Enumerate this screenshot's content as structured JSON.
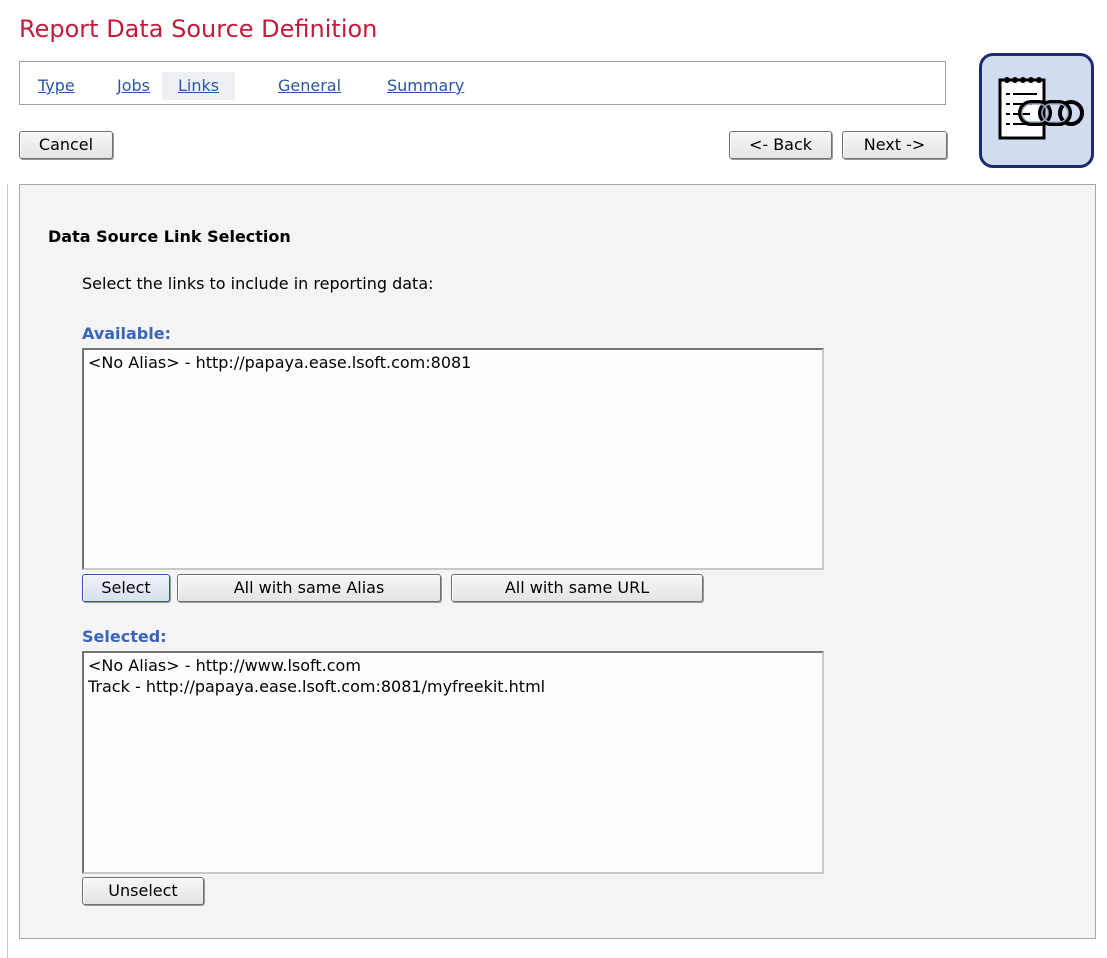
{
  "page": {
    "title": "Report Data Source Definition"
  },
  "tabs": [
    {
      "label": "Type"
    },
    {
      "label": "Jobs"
    },
    {
      "label": "Links"
    },
    {
      "label": "General"
    },
    {
      "label": "Summary"
    }
  ],
  "nav": {
    "cancel": "Cancel",
    "back": "<- Back",
    "next": "Next ->"
  },
  "logo": {
    "icon": "report-link-chain-icon"
  },
  "section": {
    "title": "Data Source Link Selection",
    "instructions": "Select the links to include in reporting data:"
  },
  "available": {
    "label": "Available:",
    "items": [
      "<No Alias> - http://papaya.ease.lsoft.com:8081"
    ],
    "buttons": {
      "select": "Select",
      "same_alias": "All with same Alias",
      "same_url": "All with same URL"
    }
  },
  "selected": {
    "label": "Selected:",
    "items": [
      "<No Alias> - http://www.lsoft.com",
      "Track - http://papaya.ease.lsoft.com:8081/myfreekit.html"
    ],
    "buttons": {
      "unselect": "Unselect"
    }
  }
}
